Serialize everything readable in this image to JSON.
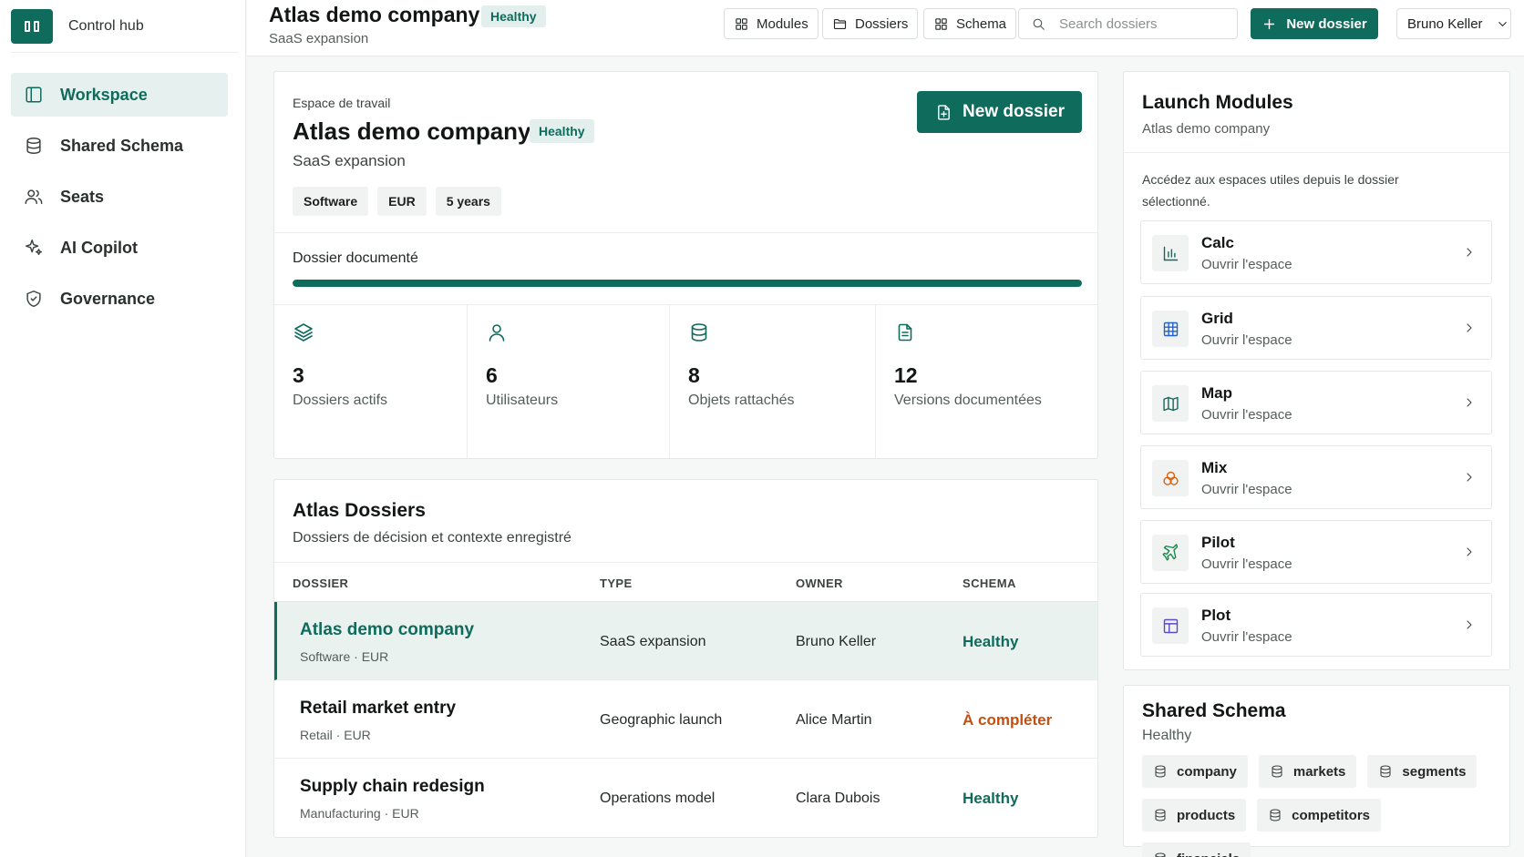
{
  "brand": {
    "name": "Control hub"
  },
  "sidebar": {
    "items": [
      {
        "label": "Workspace",
        "icon": "panel-icon",
        "active": true
      },
      {
        "label": "Shared Schema",
        "icon": "database-icon"
      },
      {
        "label": "Seats",
        "icon": "users-icon"
      },
      {
        "label": "AI Copilot",
        "icon": "sparkles-icon"
      },
      {
        "label": "Governance",
        "icon": "shield-icon"
      }
    ]
  },
  "topbar": {
    "title": "Atlas demo company",
    "badge": "Healthy",
    "subtitle": "SaaS expansion",
    "buttons": {
      "modules": "Modules",
      "dossiers": "Dossiers",
      "schema": "Schema"
    },
    "search_placeholder": "Search dossiers",
    "new_dossier": "New dossier",
    "user": "Bruno Keller"
  },
  "workspace": {
    "eyebrow": "Espace de travail",
    "title": "Atlas demo company",
    "badge": "Healthy",
    "subtitle": "SaaS expansion",
    "tags": [
      "Software",
      "EUR",
      "5 years"
    ],
    "cta": "New dossier",
    "progress_label": "Dossier documenté",
    "progress_fraction": 1.0,
    "stats": [
      {
        "value": "3",
        "label": "Dossiers actifs",
        "icon": "layers-icon"
      },
      {
        "value": "6",
        "label": "Utilisateurs",
        "icon": "user-icon"
      },
      {
        "value": "8",
        "label": "Objets rattachés",
        "icon": "database-icon"
      },
      {
        "value": "12",
        "label": "Versions documentées",
        "icon": "document-icon"
      }
    ]
  },
  "dossiers": {
    "title": "Atlas Dossiers",
    "subtitle": "Dossiers de décision et contexte enregistré",
    "columns": {
      "dossier": "DOSSIER",
      "type": "TYPE",
      "owner": "OWNER",
      "schema": "SCHEMA"
    },
    "rows": [
      {
        "name": "Atlas demo company",
        "meta": "Software · EUR",
        "type": "SaaS expansion",
        "owner": "Bruno Keller",
        "status": "Healthy",
        "status_color": "#0f6b5c",
        "selected": true
      },
      {
        "name": "Retail market entry",
        "meta": "Retail · EUR",
        "type": "Geographic launch",
        "owner": "Alice Martin",
        "status": "À compléter",
        "status_color": "#c2500f",
        "selected": false
      },
      {
        "name": "Supply chain redesign",
        "meta": "Manufacturing · EUR",
        "type": "Operations model",
        "owner": "Clara Dubois",
        "status": "Healthy",
        "status_color": "#0f6b5c",
        "selected": false
      }
    ]
  },
  "launch": {
    "title": "Launch Modules",
    "subtitle": "Atlas demo company",
    "description": "Accédez aux espaces utiles depuis le dossier sélectionné.",
    "modules": [
      {
        "name": "Calc",
        "action": "Ouvrir l'espace",
        "icon": "bar-chart-icon",
        "color": "#0f6b5c"
      },
      {
        "name": "Grid",
        "action": "Ouvrir l'espace",
        "icon": "grid-icon",
        "color": "#2563c9"
      },
      {
        "name": "Map",
        "action": "Ouvrir l'espace",
        "icon": "map-icon",
        "color": "#0f6b5c"
      },
      {
        "name": "Mix",
        "action": "Ouvrir l'espace",
        "icon": "blend-icon",
        "color": "#d9630f"
      },
      {
        "name": "Pilot",
        "action": "Ouvrir l'espace",
        "icon": "plane-icon",
        "color": "#16894a"
      },
      {
        "name": "Plot",
        "action": "Ouvrir l'espace",
        "icon": "layout-icon",
        "color": "#5b4cc4"
      }
    ]
  },
  "schema": {
    "title": "Shared Schema",
    "subtitle": "Healthy",
    "tables": [
      "company",
      "markets",
      "segments",
      "products",
      "competitors",
      "financials"
    ]
  },
  "colors": {
    "accent": "#0f6b5c",
    "warning": "#c2500f"
  }
}
